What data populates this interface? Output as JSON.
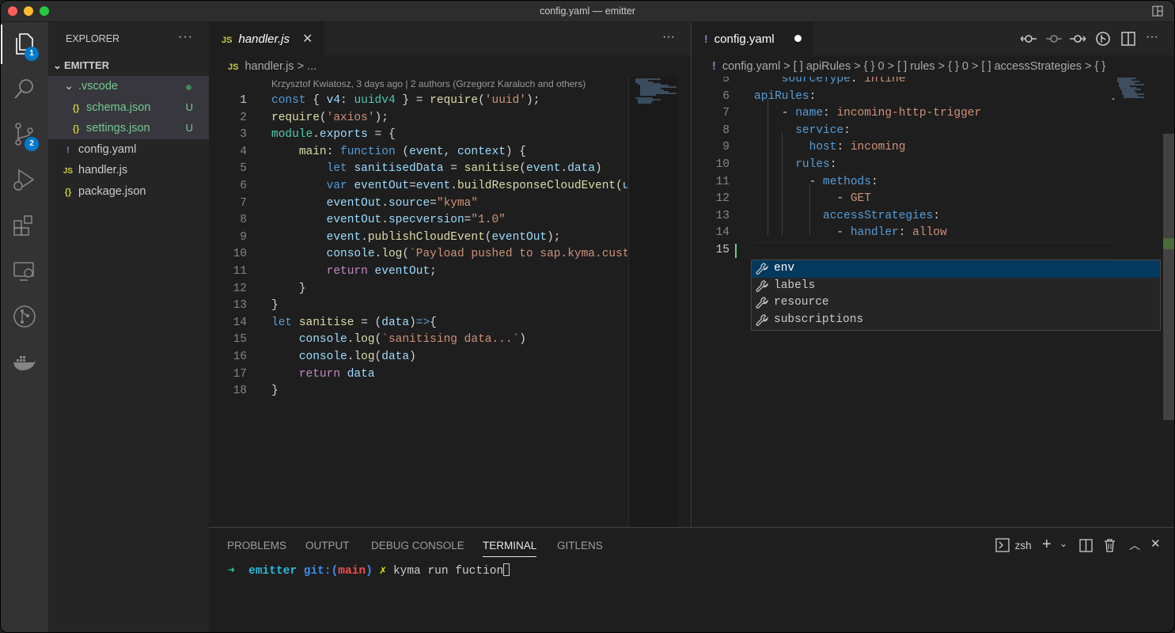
{
  "window": {
    "title": "config.yaml — emitter"
  },
  "activity": {
    "explorer_badge": "1",
    "scm_badge": "2"
  },
  "sidebar": {
    "title": "EXPLORER",
    "more": "···",
    "section": "EMITTER",
    "items": [
      {
        "label": ".vscode",
        "status_dot": true
      },
      {
        "icon": "{}",
        "label": "schema.json",
        "status": "U"
      },
      {
        "icon": "{}",
        "label": "settings.json",
        "status": "U"
      },
      {
        "icon": "!",
        "label": "config.yaml"
      },
      {
        "icon": "JS",
        "label": "handler.js"
      },
      {
        "icon": "{}",
        "label": "package.json"
      }
    ]
  },
  "left_editor": {
    "tab_icon": "JS",
    "tab_label": "handler.js",
    "more": "···",
    "breadcrumb_icon": "JS",
    "breadcrumb": "handler.js > ...",
    "codelens": "Krzysztof Kwiatosz, 3 days ago | 2 authors (Grzegorz Karaluch and others)",
    "line_numbers": [
      "1",
      "2",
      "3",
      "4",
      "5",
      "6",
      "7",
      "8",
      "9",
      "10",
      "11",
      "12",
      "13",
      "14",
      "15",
      "16",
      "17",
      "18"
    ]
  },
  "right_editor": {
    "tab_icon": "!",
    "tab_label": "config.yaml",
    "breadcrumb_icon": "!",
    "breadcrumb": "config.yaml > [ ] apiRules > { } 0 > [ ] rules > { } 0 > [ ] accessStrategies > { }",
    "line_numbers": [
      "5",
      "6",
      "7",
      "8",
      "9",
      "10",
      "11",
      "12",
      "13",
      "14",
      "15"
    ]
  },
  "suggestions": [
    "env",
    "labels",
    "resource",
    "subscriptions"
  ],
  "panel": {
    "tabs": [
      "PROBLEMS",
      "OUTPUT",
      "DEBUG CONSOLE",
      "TERMINAL",
      "GITLENS"
    ],
    "active_tab": "TERMINAL",
    "shell": "zsh",
    "prompt_arrow": "➜",
    "prompt_dir": "emitter",
    "prompt_git": "git:(",
    "prompt_branch": "main",
    "prompt_git_close": ")",
    "prompt_mark": "✗",
    "command": "kyma run fuction"
  },
  "colors": {
    "accent": "#007acc",
    "untracked": "#73c991",
    "folder": "#cccccc"
  }
}
